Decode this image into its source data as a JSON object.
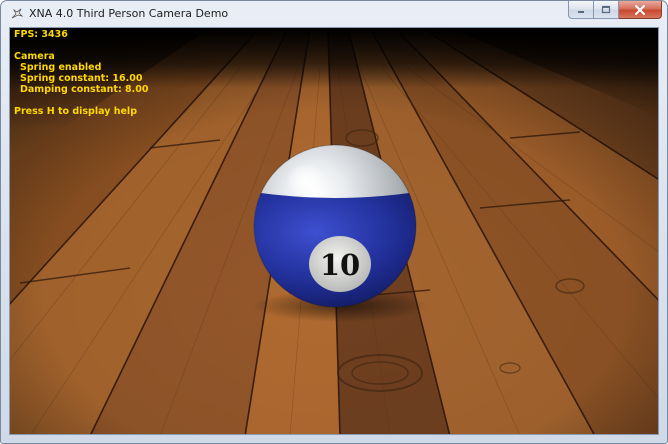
{
  "window": {
    "title": "XNA 4.0 Third Person Camera Demo",
    "icon": "xna-app-icon",
    "controls": [
      "minimize-icon",
      "maximize-icon",
      "close-icon"
    ]
  },
  "hud": {
    "fps": "FPS: 3436",
    "camera_heading": "Camera",
    "spring_status": "Spring enabled",
    "spring_constant": "Spring constant: 16.00",
    "damping_constant": "Damping constant: 8.00",
    "help_hint": "Press H to display help",
    "text_color": "#ffd800"
  },
  "scene": {
    "ball_number": "10",
    "ball_stripe_color": "#1f2f9a",
    "ball_base_color": "#e8ebee",
    "floor": "wooden-planks"
  }
}
